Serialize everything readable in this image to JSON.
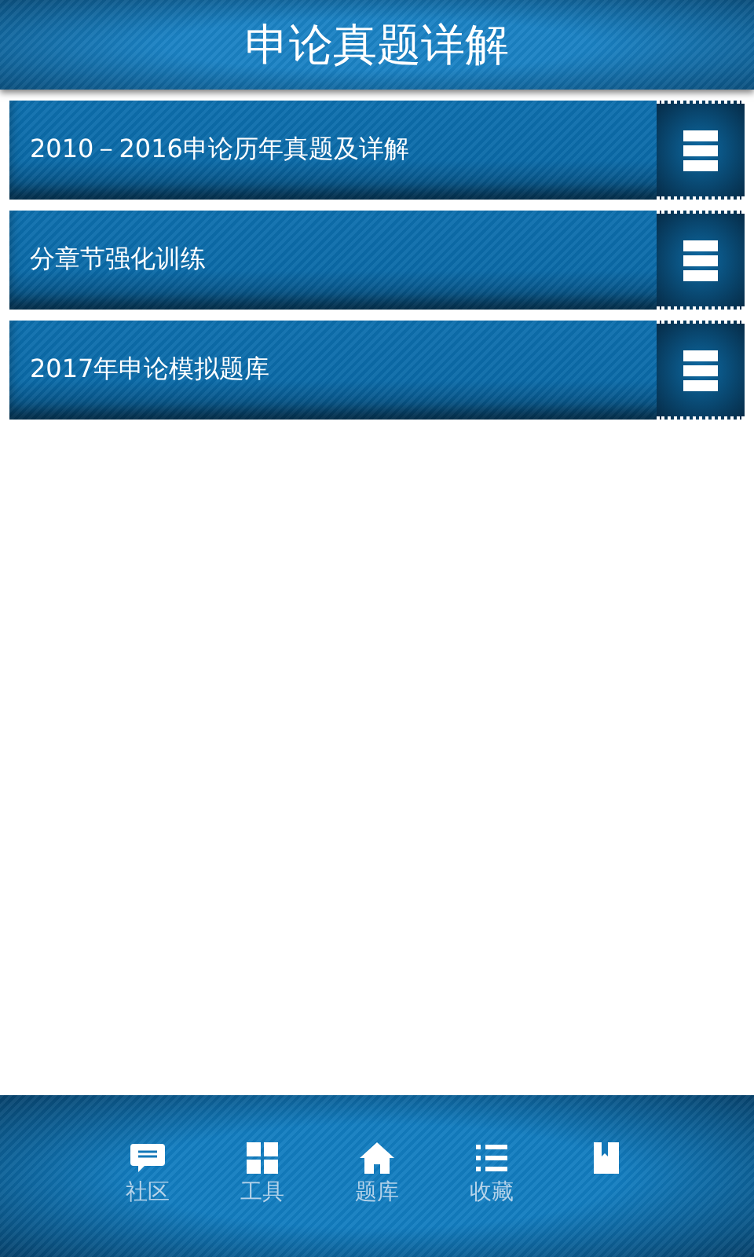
{
  "header": {
    "title": "申论真题详解"
  },
  "items": [
    {
      "label": "2010－2016申论历年真题及详解"
    },
    {
      "label": "分章节强化训练"
    },
    {
      "label": "2017年申论模拟题库"
    }
  ],
  "tabs": [
    {
      "kind": "chat",
      "label": "社区"
    },
    {
      "kind": "grid",
      "label": "工具"
    },
    {
      "kind": "home",
      "label": "题库"
    },
    {
      "kind": "list",
      "label": "收藏"
    },
    {
      "kind": "book"
    }
  ]
}
